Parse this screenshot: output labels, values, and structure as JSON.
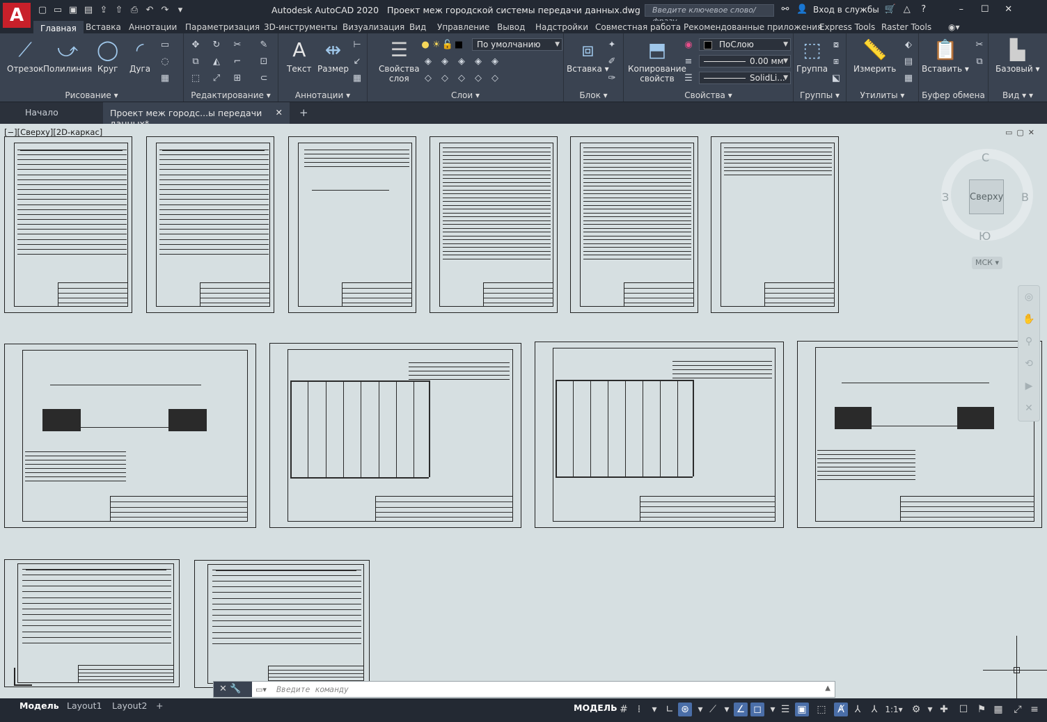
{
  "title": {
    "app_name": "Autodesk AutoCAD 2020",
    "file_name": "Проект меж городской системы передачи данных.dwg",
    "logo_letter": "A",
    "search_placeholder": "Введите ключевое слово/фразу",
    "signin": "Вход в службы"
  },
  "ribbon_tabs": [
    "Главная",
    "Вставка",
    "Аннотации",
    "Параметризация",
    "3D-инструменты",
    "Визуализация",
    "Вид",
    "Управление",
    "Вывод",
    "Надстройки",
    "Совместная работа",
    "Рекомендованные приложения",
    "Express Tools",
    "Raster Tools"
  ],
  "panels": {
    "draw": {
      "title": "Рисование",
      "line": "Отрезок",
      "polyline": "Полилиния",
      "circle": "Круг",
      "arc": "Дуга"
    },
    "modify": {
      "title": "Редактирование"
    },
    "annotation": {
      "title": "Аннотации",
      "text": "Текст",
      "dimension": "Размер"
    },
    "layers": {
      "title": "Слои",
      "props_line1": "Свойства",
      "props_line2": "слоя",
      "current_layer": "По умолчанию"
    },
    "block": {
      "title": "Блок",
      "insert": "Вставка"
    },
    "properties": {
      "title": "Свойства",
      "match_line1": "Копирование",
      "match_line2": "свойств",
      "color": "ПоСлою",
      "lineweight": "0.00 мм",
      "linetype": "SolidLi..."
    },
    "groups": {
      "title": "Группы",
      "group": "Группа"
    },
    "utilities": {
      "title": "Утилиты",
      "measure": "Измерить"
    },
    "clipboard": {
      "title": "Буфер обмена",
      "paste": "Вставить"
    },
    "view": {
      "title": "Вид",
      "base": "Базовый"
    }
  },
  "doc_tabs": {
    "start": "Начало",
    "active": "Проект меж городс...ы передачи данных*",
    "add": "+"
  },
  "viewport": {
    "label": "[−][Сверху][2D-каркас]",
    "viewcube_face": "Сверху",
    "compass": {
      "north": "С",
      "south": "Ю",
      "west": "З",
      "east": "В"
    },
    "wcs": "МСК"
  },
  "command_line": {
    "placeholder": "Введите команду"
  },
  "status": {
    "layout_tabs": [
      "Модель",
      "Layout1",
      "Layout2"
    ],
    "active_layout": "Модель",
    "model_button": "МОДЕЛЬ",
    "scale": "1:1"
  }
}
